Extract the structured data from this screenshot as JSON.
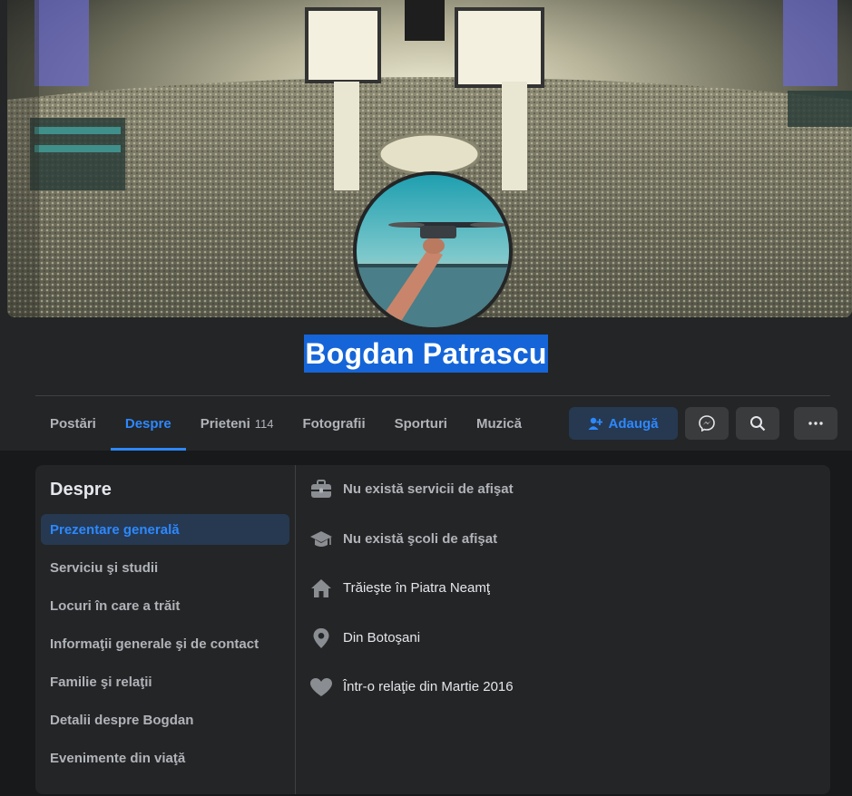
{
  "profile": {
    "name": "Bogdan Patrascu"
  },
  "tabs": [
    {
      "label": "Postări",
      "count": ""
    },
    {
      "label": "Despre",
      "count": ""
    },
    {
      "label": "Prieteni",
      "count": "114"
    },
    {
      "label": "Fotografii",
      "count": ""
    },
    {
      "label": "Sporturi",
      "count": ""
    },
    {
      "label": "Muzică",
      "count": ""
    }
  ],
  "actions": {
    "add_label": "Adaugă"
  },
  "about": {
    "title": "Despre",
    "sections": [
      "Prezentare generală",
      "Serviciu şi studii",
      "Locuri în care a trăit",
      "Informaţii generale şi de contact",
      "Familie şi relaţii",
      "Detalii despre Bogdan",
      "Evenimente din viaţă"
    ],
    "overview": [
      {
        "icon": "briefcase-icon",
        "text": "Nu există servicii de afişat"
      },
      {
        "icon": "graduation-cap-icon",
        "text": "Nu există şcoli de afişat"
      },
      {
        "icon": "home-icon",
        "text": "Trăieşte în Piatra Neamţ"
      },
      {
        "icon": "location-pin-icon",
        "text": "Din Botoşani"
      },
      {
        "icon": "heart-icon",
        "text": "Într-o relaţie din Martie 2016"
      }
    ]
  },
  "colors": {
    "accent": "#2d88ff",
    "name_highlight": "#1565d8",
    "surface": "#242526",
    "background": "#18191a"
  }
}
